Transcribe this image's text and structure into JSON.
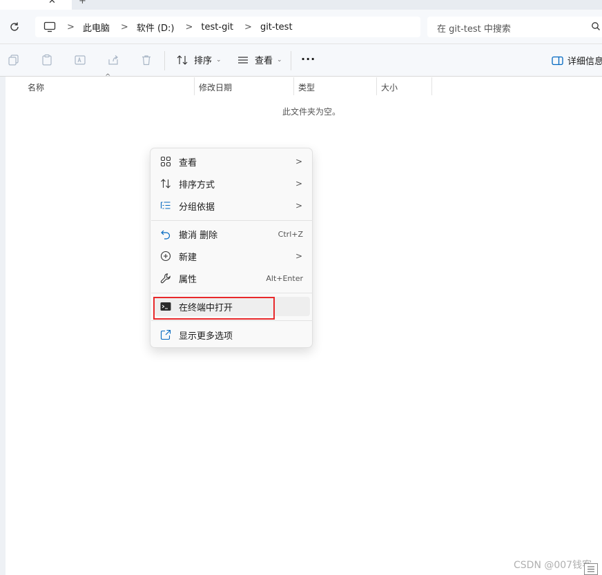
{
  "tabs": {
    "close_glyph": "✕",
    "new_glyph": "+"
  },
  "address": {
    "crumbs": [
      "此电脑",
      "软件 (D:)",
      "test-git",
      "git-test"
    ],
    "separator": ">"
  },
  "search": {
    "placeholder": "在 git-test 中搜索"
  },
  "toolbar": {
    "sort_label": "排序",
    "view_label": "查看",
    "more_label": "···",
    "details_label": "详细信息"
  },
  "columns": {
    "name": "名称",
    "modified": "修改日期",
    "type": "类型",
    "size": "大小"
  },
  "empty_message": "此文件夹为空。",
  "context_menu": {
    "items": [
      {
        "label": "查看",
        "icon": "grid-icon",
        "submenu": true
      },
      {
        "label": "排序方式",
        "icon": "sort-icon",
        "submenu": true
      },
      {
        "label": "分组依据",
        "icon": "group-list-icon",
        "submenu": true
      },
      {
        "label": "撤消 删除",
        "icon": "undo-icon",
        "shortcut": "Ctrl+Z"
      },
      {
        "label": "新建",
        "icon": "new-plus-icon",
        "submenu": true
      },
      {
        "label": "属性",
        "icon": "wrench-icon",
        "shortcut": "Alt+Enter"
      },
      {
        "label": "在终端中打开",
        "icon": "terminal-icon",
        "highlighted": true
      },
      {
        "label": "显示更多选项",
        "icon": "expand-icon"
      }
    ],
    "arrow_glyph": ">"
  },
  "watermark": "CSDN @007钱客",
  "colors": {
    "highlight_box": "#e8282a",
    "accent": "#0067c0"
  }
}
